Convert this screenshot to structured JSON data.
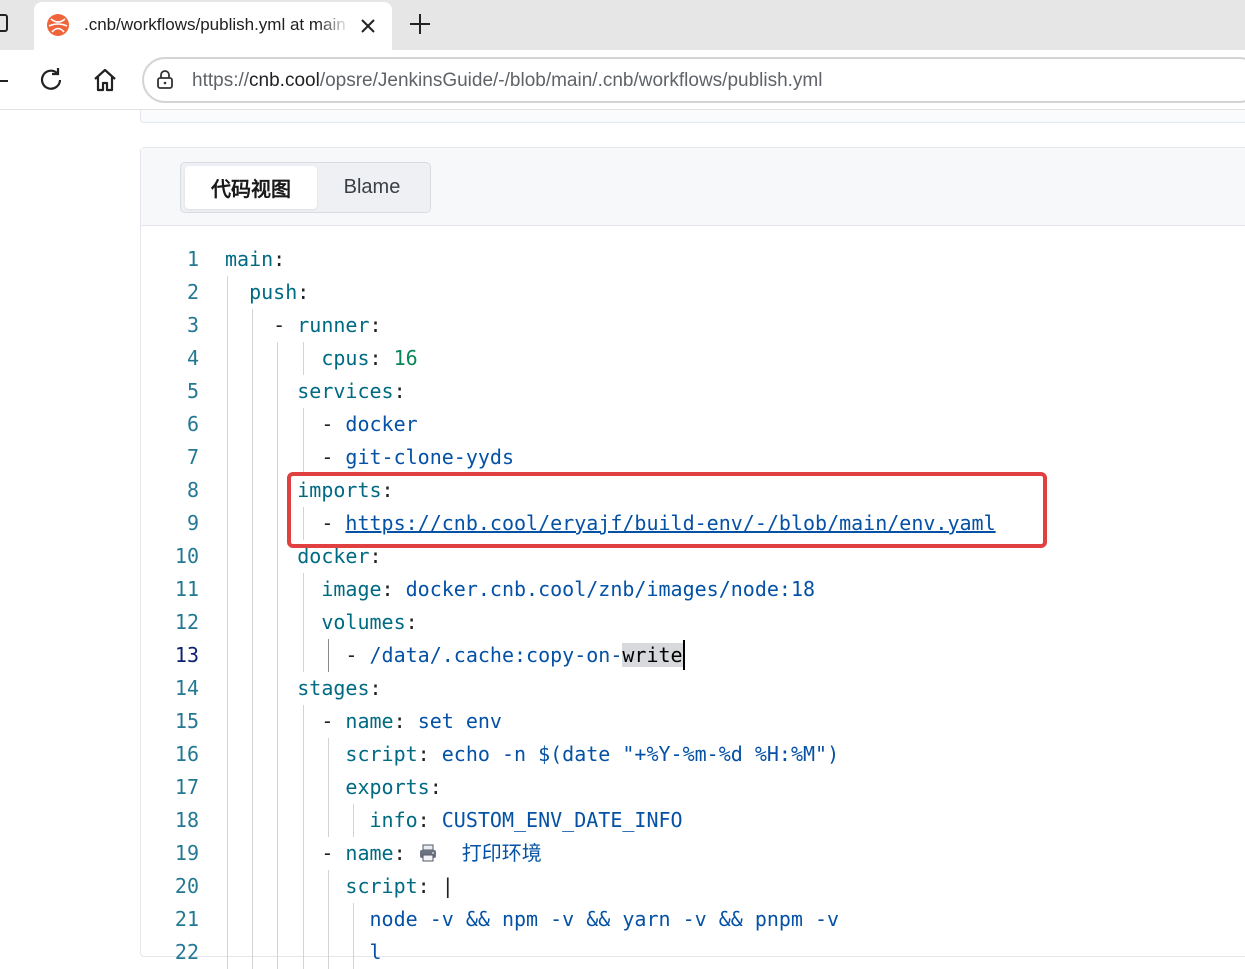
{
  "browser": {
    "tab_title": ".cnb/workflows/publish.yml at main",
    "url_scheme": "https://",
    "url_host": "cnb.cool",
    "url_path": "/opsre/JenkinsGuide/-/blob/main/.cnb/workflows/publish.yml"
  },
  "viewer": {
    "tab_code": "代码视图",
    "tab_blame": "Blame"
  },
  "code_lines": [
    {
      "n": "1",
      "parts": [
        [
          "k",
          "main"
        ],
        [
          "p",
          ":"
        ]
      ]
    },
    {
      "n": "2",
      "parts": [
        [
          "p",
          "  "
        ],
        [
          "k",
          "push"
        ],
        [
          "p",
          ":"
        ]
      ]
    },
    {
      "n": "3",
      "parts": [
        [
          "p",
          "    - "
        ],
        [
          "k",
          "runner"
        ],
        [
          "p",
          ":"
        ]
      ]
    },
    {
      "n": "4",
      "parts": [
        [
          "p",
          "        "
        ],
        [
          "k",
          "cpus"
        ],
        [
          "p",
          ": "
        ],
        [
          "n",
          "16"
        ]
      ]
    },
    {
      "n": "5",
      "parts": [
        [
          "p",
          "      "
        ],
        [
          "k",
          "services"
        ],
        [
          "p",
          ":"
        ]
      ]
    },
    {
      "n": "6",
      "parts": [
        [
          "p",
          "        - "
        ],
        [
          "v",
          "docker"
        ]
      ]
    },
    {
      "n": "7",
      "parts": [
        [
          "p",
          "        - "
        ],
        [
          "v",
          "git-clone-yyds"
        ]
      ]
    },
    {
      "n": "8",
      "parts": [
        [
          "p",
          "      "
        ],
        [
          "k",
          "imports"
        ],
        [
          "p",
          ":"
        ]
      ]
    },
    {
      "n": "9",
      "parts": [
        [
          "p",
          "        - "
        ],
        [
          "link",
          "https://cnb.cool/eryajf/build-env/-/blob/main/env.yaml"
        ]
      ]
    },
    {
      "n": "10",
      "parts": [
        [
          "p",
          "      "
        ],
        [
          "k",
          "docker"
        ],
        [
          "p",
          ":"
        ]
      ]
    },
    {
      "n": "11",
      "parts": [
        [
          "p",
          "        "
        ],
        [
          "k",
          "image"
        ],
        [
          "p",
          ": "
        ],
        [
          "v",
          "docker.cnb.cool/znb/images/node:18"
        ]
      ]
    },
    {
      "n": "12",
      "parts": [
        [
          "p",
          "        "
        ],
        [
          "k",
          "volumes"
        ],
        [
          "p",
          ":"
        ]
      ]
    },
    {
      "n": "13",
      "parts": [
        [
          "p",
          "          - "
        ],
        [
          "v",
          "/data/.cache:copy-on-"
        ],
        [
          "sel",
          "write"
        ]
      ]
    },
    {
      "n": "14",
      "parts": [
        [
          "p",
          "      "
        ],
        [
          "k",
          "stages"
        ],
        [
          "p",
          ":"
        ]
      ]
    },
    {
      "n": "15",
      "parts": [
        [
          "p",
          "        - "
        ],
        [
          "k",
          "name"
        ],
        [
          "p",
          ": "
        ],
        [
          "v",
          "set env"
        ]
      ]
    },
    {
      "n": "16",
      "parts": [
        [
          "p",
          "          "
        ],
        [
          "k",
          "script"
        ],
        [
          "p",
          ": "
        ],
        [
          "v",
          "echo -n $(date \"+%Y-%m-%d %H:%M\")"
        ]
      ]
    },
    {
      "n": "17",
      "parts": [
        [
          "p",
          "          "
        ],
        [
          "k",
          "exports"
        ],
        [
          "p",
          ":"
        ]
      ]
    },
    {
      "n": "18",
      "parts": [
        [
          "p",
          "            "
        ],
        [
          "k",
          "info"
        ],
        [
          "p",
          ": "
        ],
        [
          "v",
          "CUSTOM_ENV_DATE_INFO"
        ]
      ]
    },
    {
      "n": "19",
      "parts": [
        [
          "p",
          "        - "
        ],
        [
          "k",
          "name"
        ],
        [
          "p",
          ": "
        ],
        [
          "emoji",
          "printer"
        ],
        [
          "v",
          " 打印环境"
        ]
      ]
    },
    {
      "n": "20",
      "parts": [
        [
          "p",
          "          "
        ],
        [
          "k",
          "script"
        ],
        [
          "p",
          ": |"
        ]
      ]
    },
    {
      "n": "21",
      "parts": [
        [
          "p",
          "            "
        ],
        [
          "v",
          "node -v && npm -v && yarn -v && pnpm -v"
        ]
      ]
    },
    {
      "n": "22",
      "parts": [
        [
          "p",
          "            "
        ],
        [
          "v",
          "l"
        ]
      ]
    }
  ],
  "current_line": "13",
  "colors": {
    "key": "#006a83",
    "value": "#0451a5",
    "number": "#098658",
    "highlight_border": "#e0403f",
    "line_number": "#237893"
  }
}
